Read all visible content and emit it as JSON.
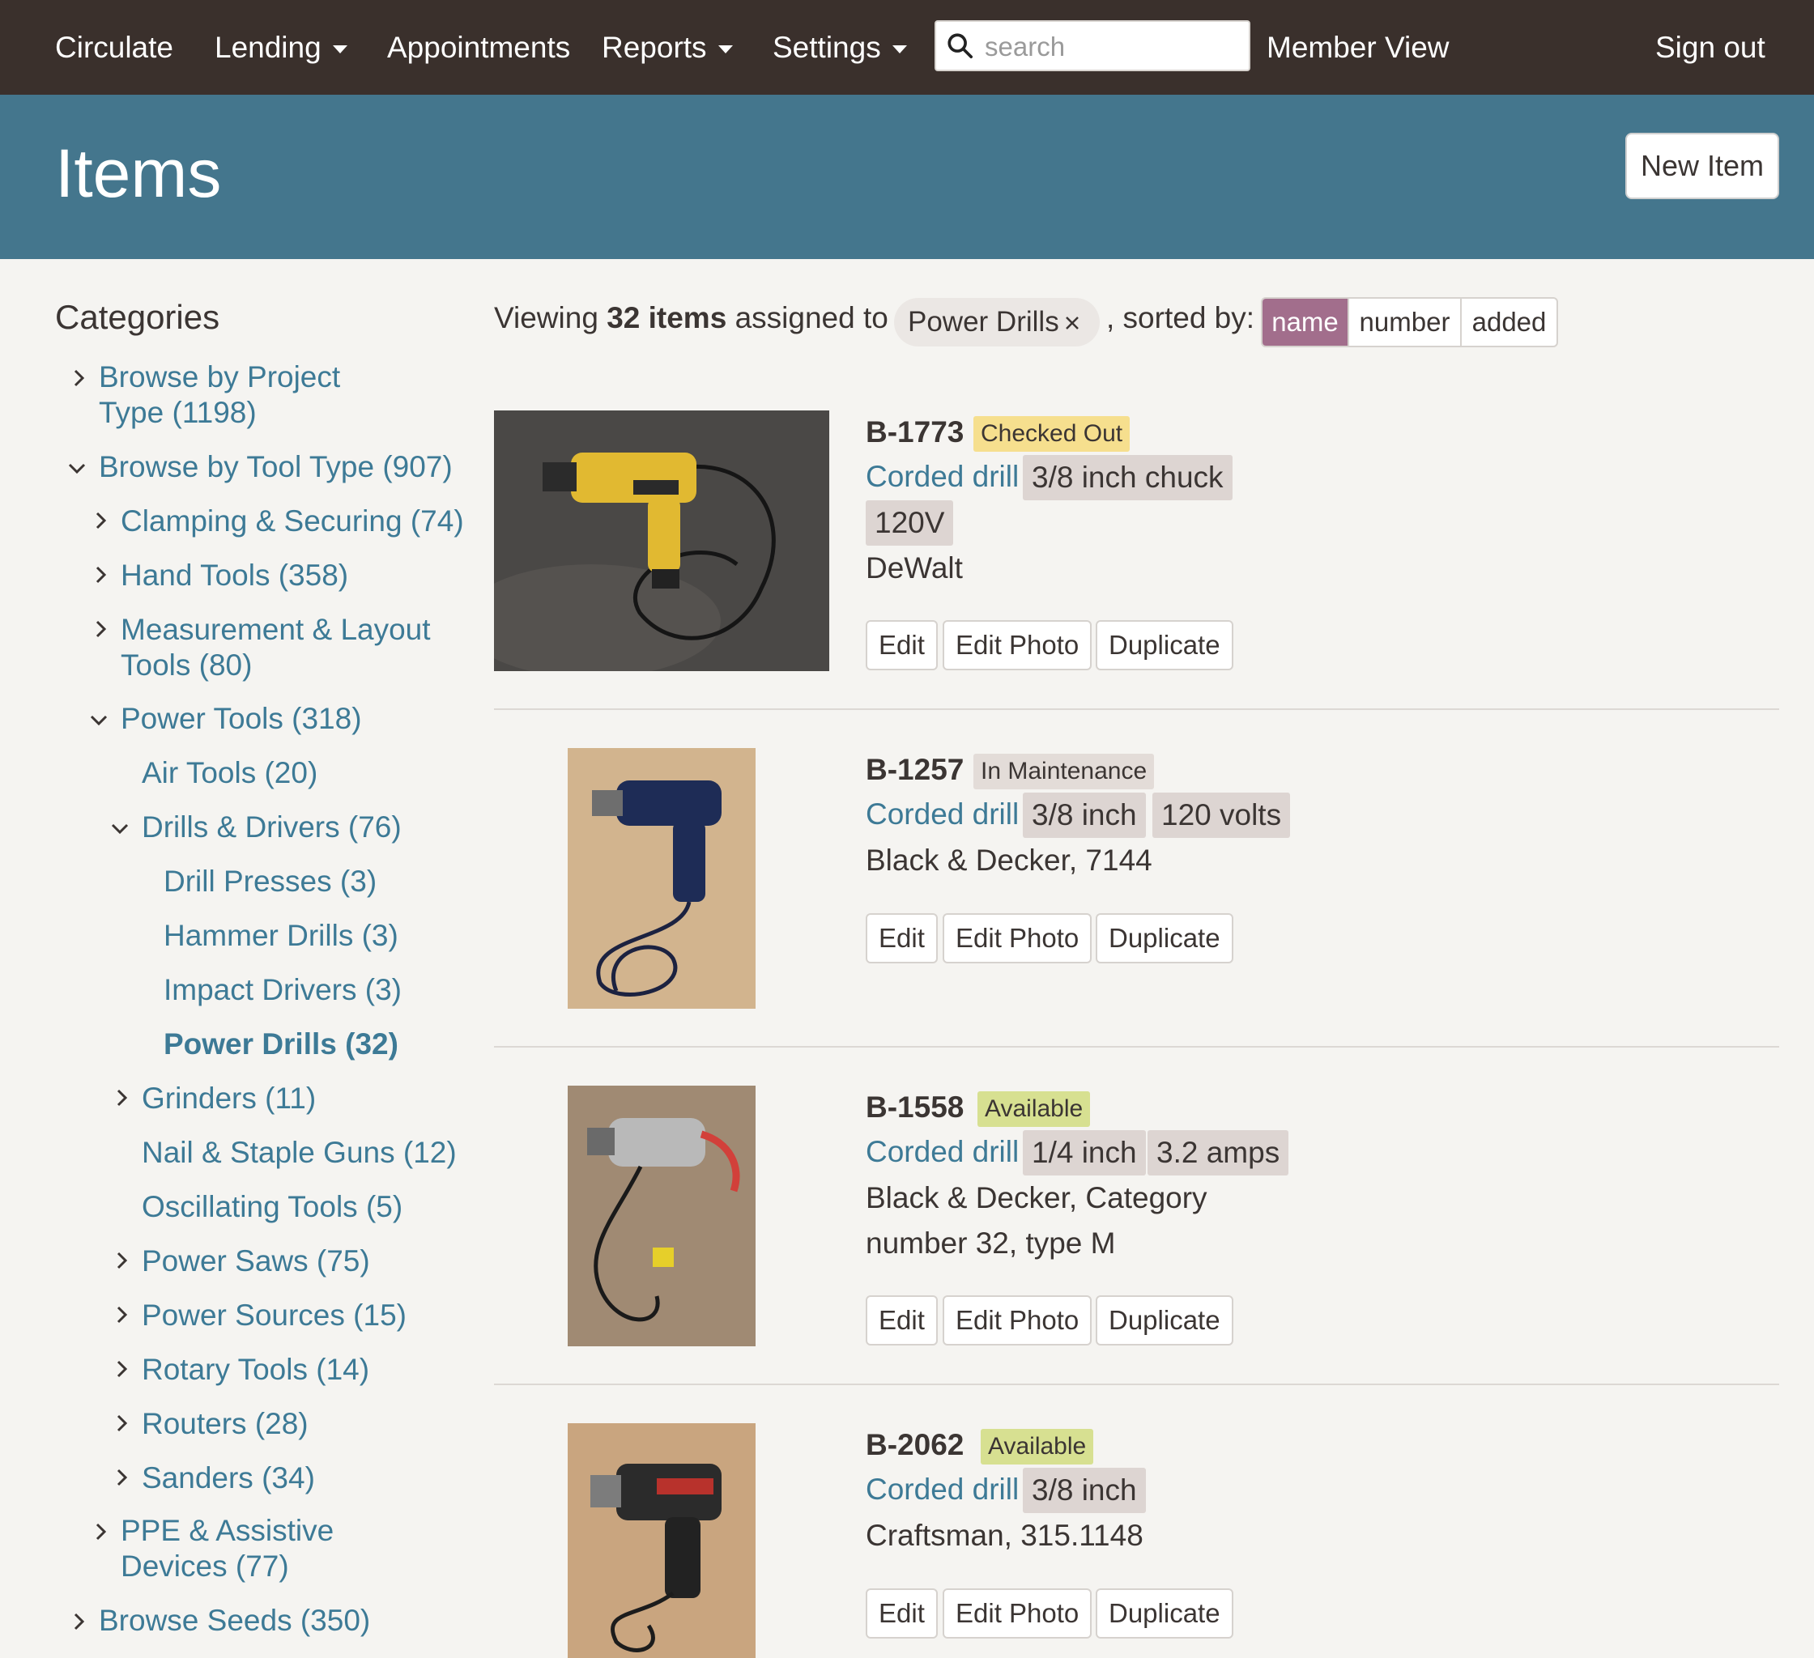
{
  "nav": {
    "brand": "Circulate",
    "lending": "Lending",
    "appointments": "Appointments",
    "reports": "Reports",
    "settings": "Settings",
    "search_placeholder": "search",
    "member_view": "Member View",
    "sign_out": "Sign out"
  },
  "header": {
    "title": "Items",
    "new_item": "New Item"
  },
  "sidebar": {
    "title": "Categories",
    "items": [
      {
        "label": "Browse by Project",
        "label2": "Type (1198)"
      },
      {
        "label": "Browse by Tool Type (907)"
      },
      {
        "label": "Clamping & Securing (74)"
      },
      {
        "label": "Hand Tools (358)"
      },
      {
        "label": "Measurement & Layout",
        "label2": "Tools (80)"
      },
      {
        "label": "Power Tools (318)"
      },
      {
        "label": "Air Tools (20)"
      },
      {
        "label": "Drills & Drivers (76)"
      },
      {
        "label": "Drill Presses (3)"
      },
      {
        "label": "Hammer Drills (3)"
      },
      {
        "label": "Impact Drivers (3)"
      },
      {
        "label": "Power Drills (32)"
      },
      {
        "label": "Grinders (11)"
      },
      {
        "label": "Nail & Staple Guns (12)"
      },
      {
        "label": "Oscillating Tools (5)"
      },
      {
        "label": "Power Saws (75)"
      },
      {
        "label": "Power Sources (15)"
      },
      {
        "label": "Rotary Tools (14)"
      },
      {
        "label": "Routers (28)"
      },
      {
        "label": "Sanders (34)"
      },
      {
        "label": "PPE & Assistive",
        "label2": "Devices (77)"
      },
      {
        "label": "Browse Seeds (350)"
      }
    ]
  },
  "summary": {
    "prefix": "Viewing",
    "count": "32 items",
    "middle": "assigned to",
    "filter": "Power Drills",
    "sorted_by": ", sorted by:",
    "sort_options": [
      "name",
      "number",
      "added"
    ],
    "active_sort": "name"
  },
  "actions": {
    "edit": "Edit",
    "edit_photo": "Edit Photo",
    "duplicate": "Duplicate"
  },
  "items": [
    {
      "number": "B-1773",
      "status": "Checked Out",
      "type": "Corded drill",
      "attrs": [
        "3/8 inch chuck",
        "120V"
      ],
      "maker": "DeWalt"
    },
    {
      "number": "B-1257",
      "status": "In Maintenance",
      "type": "Corded drill",
      "attrs": [
        "3/8 inch",
        "120 volts"
      ],
      "maker": "Black & Decker, 7144"
    },
    {
      "number": "B-1558",
      "status": "Available",
      "type": "Corded drill",
      "attrs": [
        "1/4 inch",
        "3.2 amps"
      ],
      "maker": "Black & Decker, Category",
      "maker2": "number 32, type M"
    },
    {
      "number": "B-2062",
      "status": "Available",
      "type": "Corded drill",
      "attrs": [
        "3/8 inch"
      ],
      "maker": "Craftsman, 315.1148"
    }
  ],
  "colors": {
    "topbar": "#3a302c",
    "header": "#44768d",
    "link": "#3d7a96",
    "sort_active": "#a26e8c",
    "checked_out": "#f6df8e",
    "in_maintenance": "#e3dcd8",
    "available": "#d7e091"
  },
  "icons": {
    "search": "search-icon",
    "dropdown": "caret-down-icon",
    "remove": "close-icon",
    "expand": "chevron-right-icon",
    "collapse": "chevron-down-icon"
  }
}
